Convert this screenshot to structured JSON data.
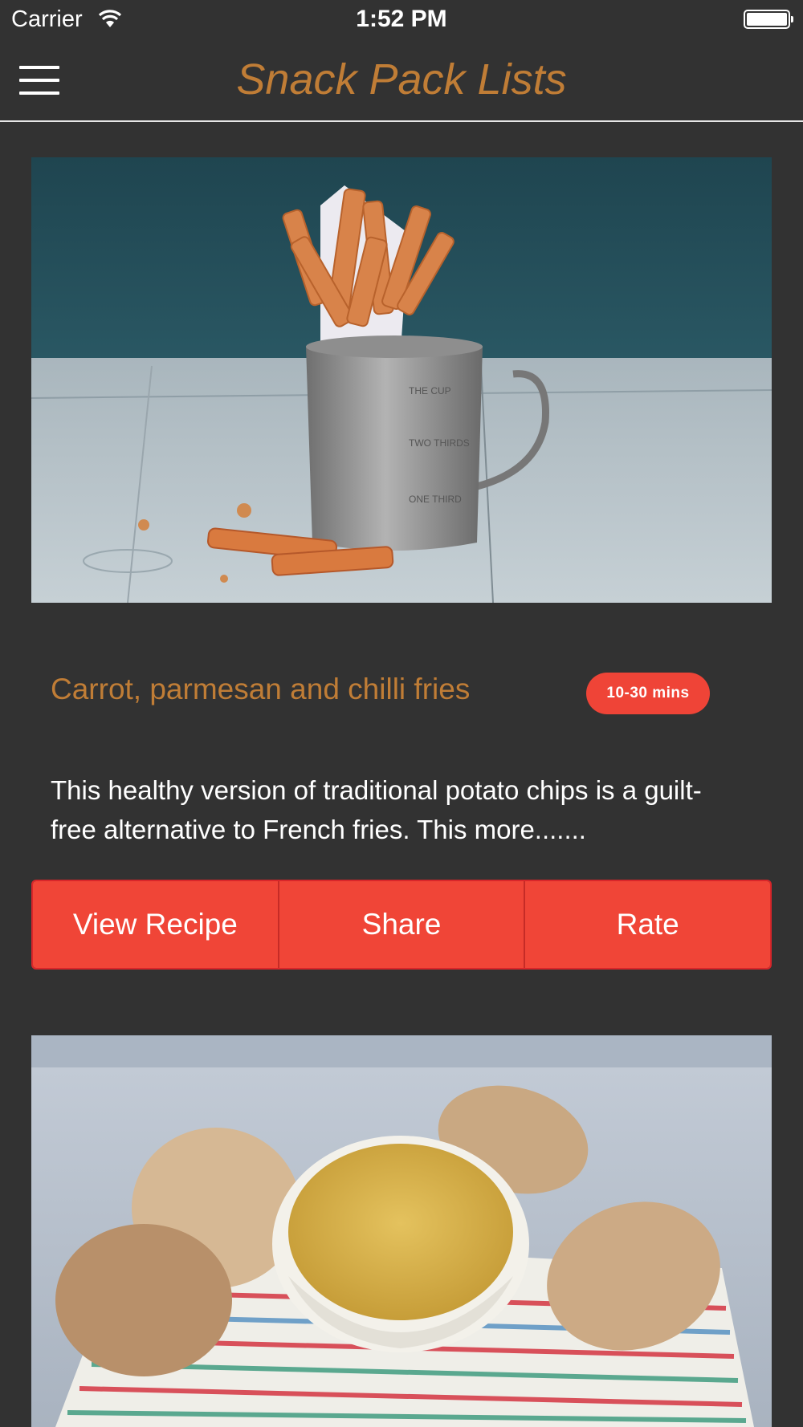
{
  "status_bar": {
    "carrier": "Carrier",
    "time": "1:52 PM"
  },
  "nav": {
    "title": "Snack Pack Lists",
    "menu_icon": "hamburger-menu-icon"
  },
  "colors": {
    "background": "#323232",
    "accent": "#c07d36",
    "button_red": "#f04537"
  },
  "cards": [
    {
      "title": "Carrot, parmesan and chilli fries",
      "time_badge": "10-30 mins",
      "description": "This healthy version of traditional potato chips is a guilt-free alternative to French fries. This more.......",
      "actions": [
        "View Recipe",
        "Share",
        "Rate"
      ]
    },
    {}
  ]
}
